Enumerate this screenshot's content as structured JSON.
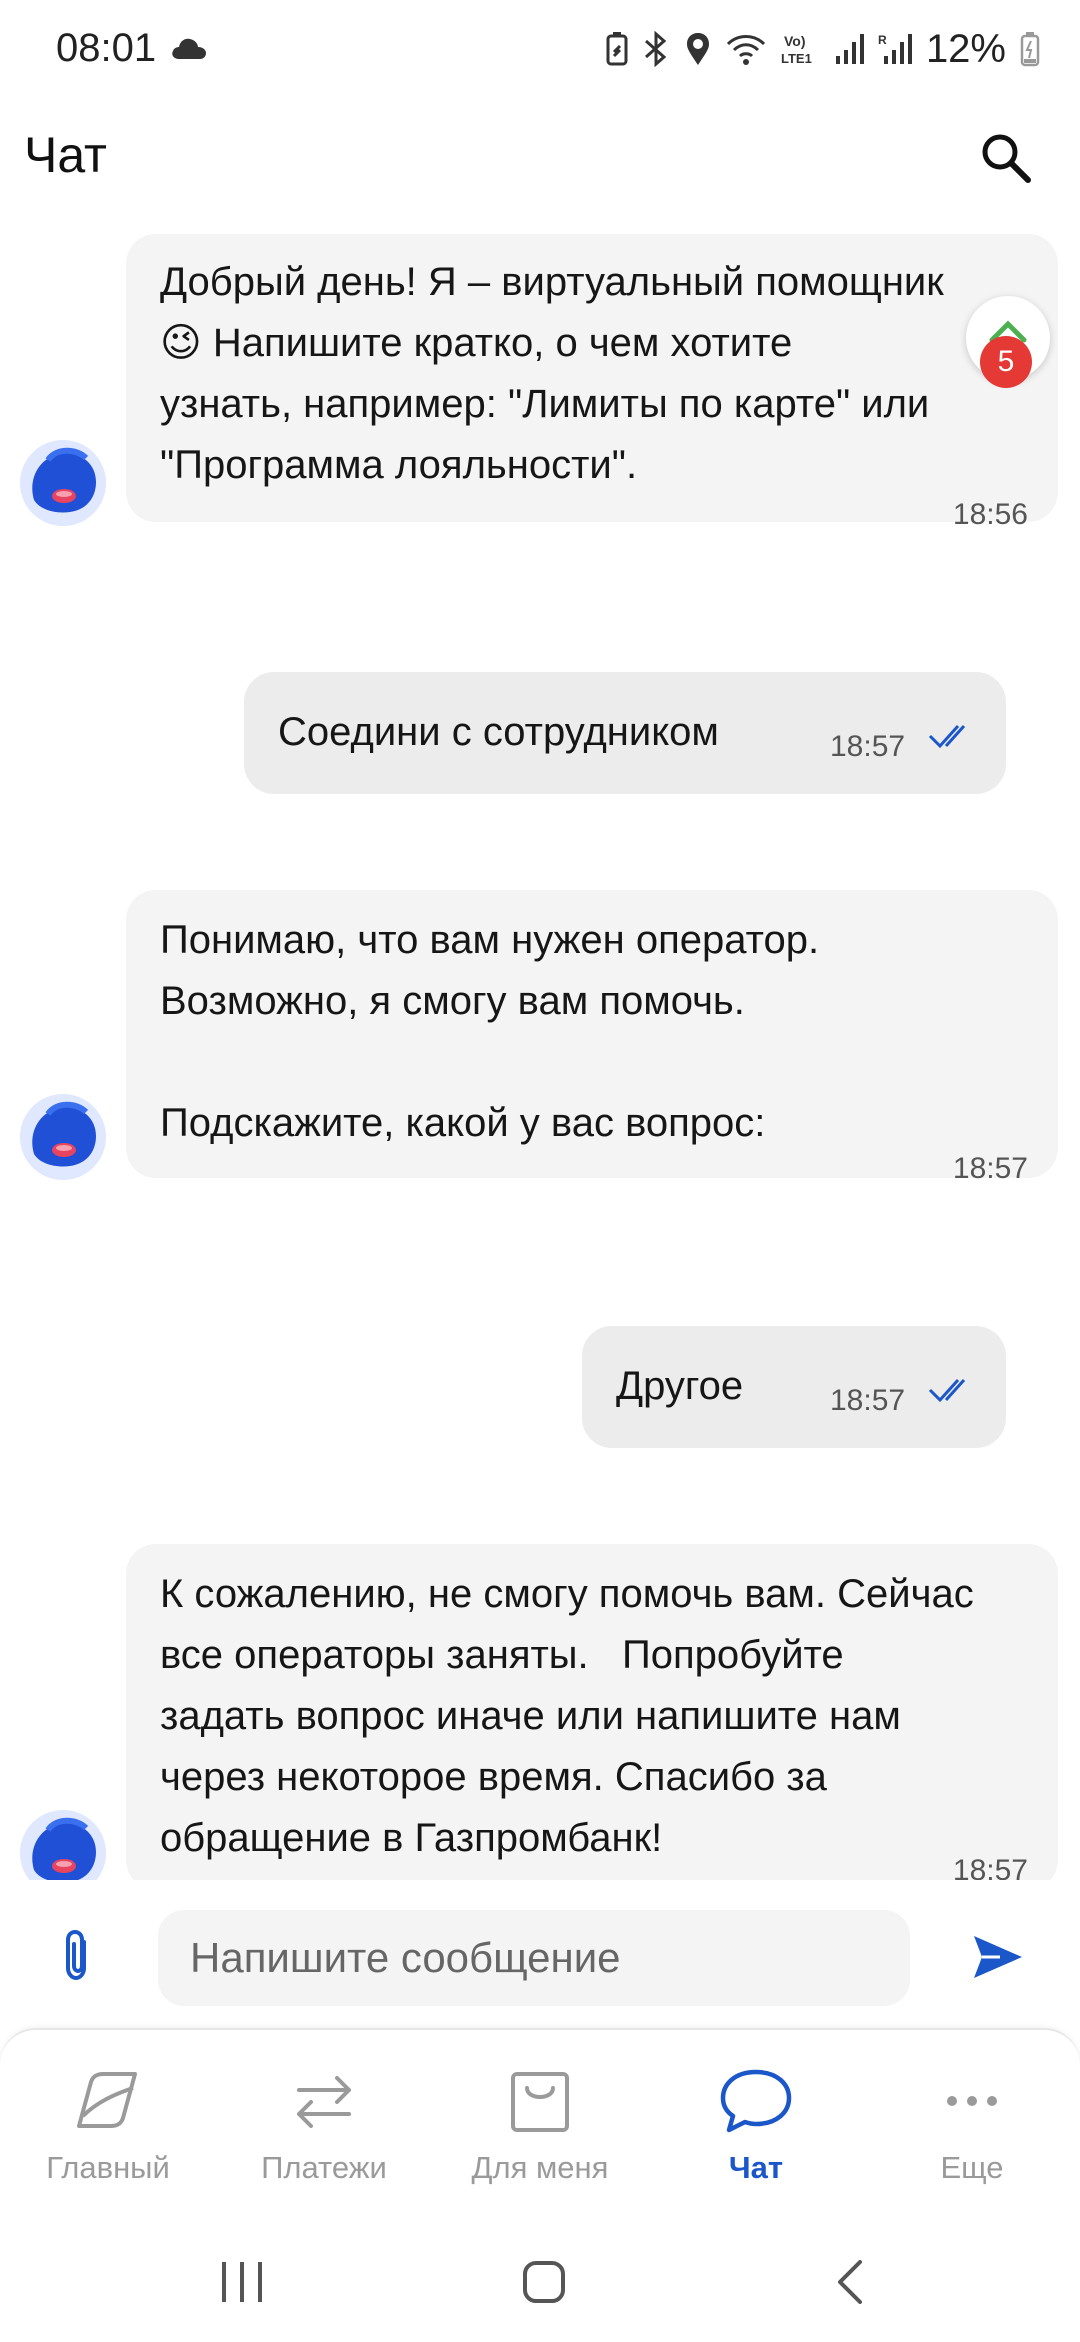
{
  "status_bar": {
    "time": "08:01",
    "battery": "12%",
    "network": "Vo) LTE1",
    "icons": [
      "cloud-icon",
      "battery-saver-icon",
      "bluetooth-icon",
      "location-icon",
      "wifi-icon",
      "volte-icon",
      "signal-icon",
      "signal-roaming-icon",
      "battery-icon"
    ]
  },
  "header": {
    "title": "Чат",
    "search_icon": "search-icon"
  },
  "messages": [
    {
      "sender": "bot",
      "text": "Добрый день! Я – виртуальный помощник\n😉 Напишите кратко, о чем хотите\nузнать, например: \"Лимиты по карте\" или\n\"Программа лояльности\".",
      "time": "18:56"
    },
    {
      "sender": "user",
      "text": "Соедини с сотрудником",
      "time": "18:57",
      "status": "read"
    },
    {
      "sender": "bot",
      "text": "Понимаю, что вам нужен оператор.\nВозможно, я смогу вам помочь.\n\nПодскажите, какой у вас вопрос:",
      "time": "18:57"
    },
    {
      "sender": "user",
      "text": "Другое",
      "time": "18:57",
      "status": "read"
    },
    {
      "sender": "bot",
      "text": "К сожалению, не смогу помочь вам. Сейчас\nвсе операторы заняты.   Попробуйте\nзадать вопрос иначе или напишите нам\nчерез некоторое время. Спасибо за\nобращение в Газпромбанк!",
      "time": "18:57"
    }
  ],
  "scroll_badge": {
    "count": "5",
    "icon": "arrow-up-icon"
  },
  "composer": {
    "placeholder": "Напишите сообщение",
    "value": "",
    "attach_icon": "paperclip-icon",
    "send_icon": "send-icon"
  },
  "bottom_nav": {
    "items": [
      {
        "label": "Главный",
        "icon": "home-card-icon",
        "active": false
      },
      {
        "label": "Платежи",
        "icon": "transfer-arrows-icon",
        "active": false
      },
      {
        "label": "Для меня",
        "icon": "shopping-bag-icon",
        "active": false
      },
      {
        "label": "Чат",
        "icon": "chat-bubble-icon",
        "active": true
      },
      {
        "label": "Еще",
        "icon": "more-dots-icon",
        "active": false
      }
    ]
  },
  "colors": {
    "accent": "#1b57c9",
    "badge": "#e53935",
    "bubble_bot": "#f4f4f4",
    "bubble_user": "#ececec",
    "inactive": "#9a9a9a"
  }
}
